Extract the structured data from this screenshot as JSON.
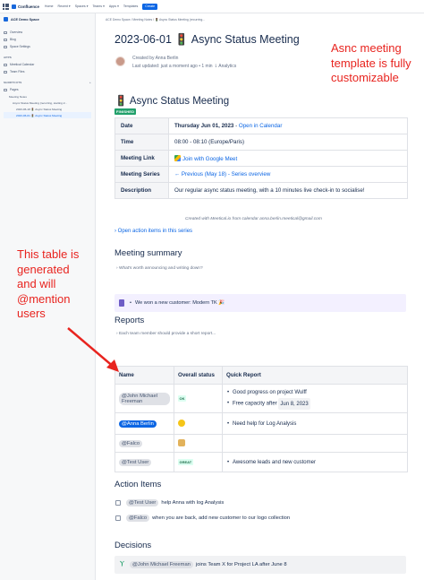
{
  "topnav": {
    "logo": "Confluence",
    "items": [
      "Home",
      "Recent ▾",
      "Spaces ▾",
      "Teams ▾",
      "Apps ▾",
      "Templates"
    ],
    "create": "Create"
  },
  "sidebar": {
    "space": "ACE Demo Space",
    "items": [
      "Overview",
      "Blog",
      "Space Settings"
    ],
    "apps_head": "APPS",
    "apps": [
      "Meetical Calendar",
      "Team Files"
    ],
    "shortcuts_head": "SHORTCUTS",
    "pages_label": "Pages",
    "tree": [
      "Meeting Notes",
      "Async Status Meeting (recurring, starting 2...",
      "2023-06-18 🚦 Async Status Meeting",
      "2023-06-01 🚦 Async Status Meeting"
    ]
  },
  "page": {
    "breadcrumb": "ACE Demo Space  /  Meeting Notes  /  🚦 Async Status Meeting (recurring...",
    "title": "2023-06-01 🚦 Async Status Meeting",
    "created_by": "Created by Anna Berlin",
    "last_updated": "Last updated: just a moment ago  •  1 min  ⇂  Analytics"
  },
  "meeting": {
    "heading": "🚦 Async Status Meeting",
    "badge": "FINISHED",
    "rows": [
      {
        "k": "Date",
        "v": "Thursday Jun 01, 2023",
        "link": "Open in Calendar"
      },
      {
        "k": "Time",
        "v": "08:00 - 08:10 (Europe/Paris)",
        "link": ""
      },
      {
        "k": "Meeting Link",
        "v": "",
        "link": "Join with Google Meet"
      },
      {
        "k": "Meeting Series",
        "v": "",
        "link": "← Previous (May 18) - Series overview"
      },
      {
        "k": "Description",
        "v": "Our regular async status meeting, with a 10 minutes live check-in to socialise!",
        "link": ""
      }
    ],
    "credit": "Created with Meetical.io from calendar anna.berlin.meetical@gmail.com",
    "open_actions": "Open action items in this series"
  },
  "summary": {
    "heading": "Meeting summary",
    "hint": "What's worth announcing and writing down?",
    "note": "We won a new customer: Modern TK 🎉"
  },
  "reports": {
    "heading": "Reports",
    "hint": "Each team member should provide a short report...",
    "headers": [
      "Name",
      "Overall status",
      "Quick Report"
    ],
    "r1": {
      "name": "@John Michael Freeman",
      "status": "OK",
      "b1": "Good progress on project Wulff",
      "b2": "Free capacity after",
      "date": "Jun 8, 2023"
    },
    "r2": {
      "name": "@Anna Berlin",
      "b1": "Need help for Log Analysis"
    },
    "r3": {
      "name": "@Falco"
    },
    "r4": {
      "name": "@Test User",
      "status": "GREAT",
      "b1": "Awesome leads and new customer"
    }
  },
  "actions": {
    "heading": "Action Items",
    "i1": {
      "m": "@Test User",
      "t": "help Anna with log Analysis"
    },
    "i2": {
      "m": "@Falco",
      "t": "when you are back, add new customer to our logo collection"
    }
  },
  "decisions": {
    "heading": "Decisions",
    "m": "@John Michael Freeman",
    "t": "joins Team X for Project LA after June 8"
  },
  "annotations": {
    "right": "Asnc meeting template is fully customizable",
    "left": "This table is generated and will @mention users"
  }
}
